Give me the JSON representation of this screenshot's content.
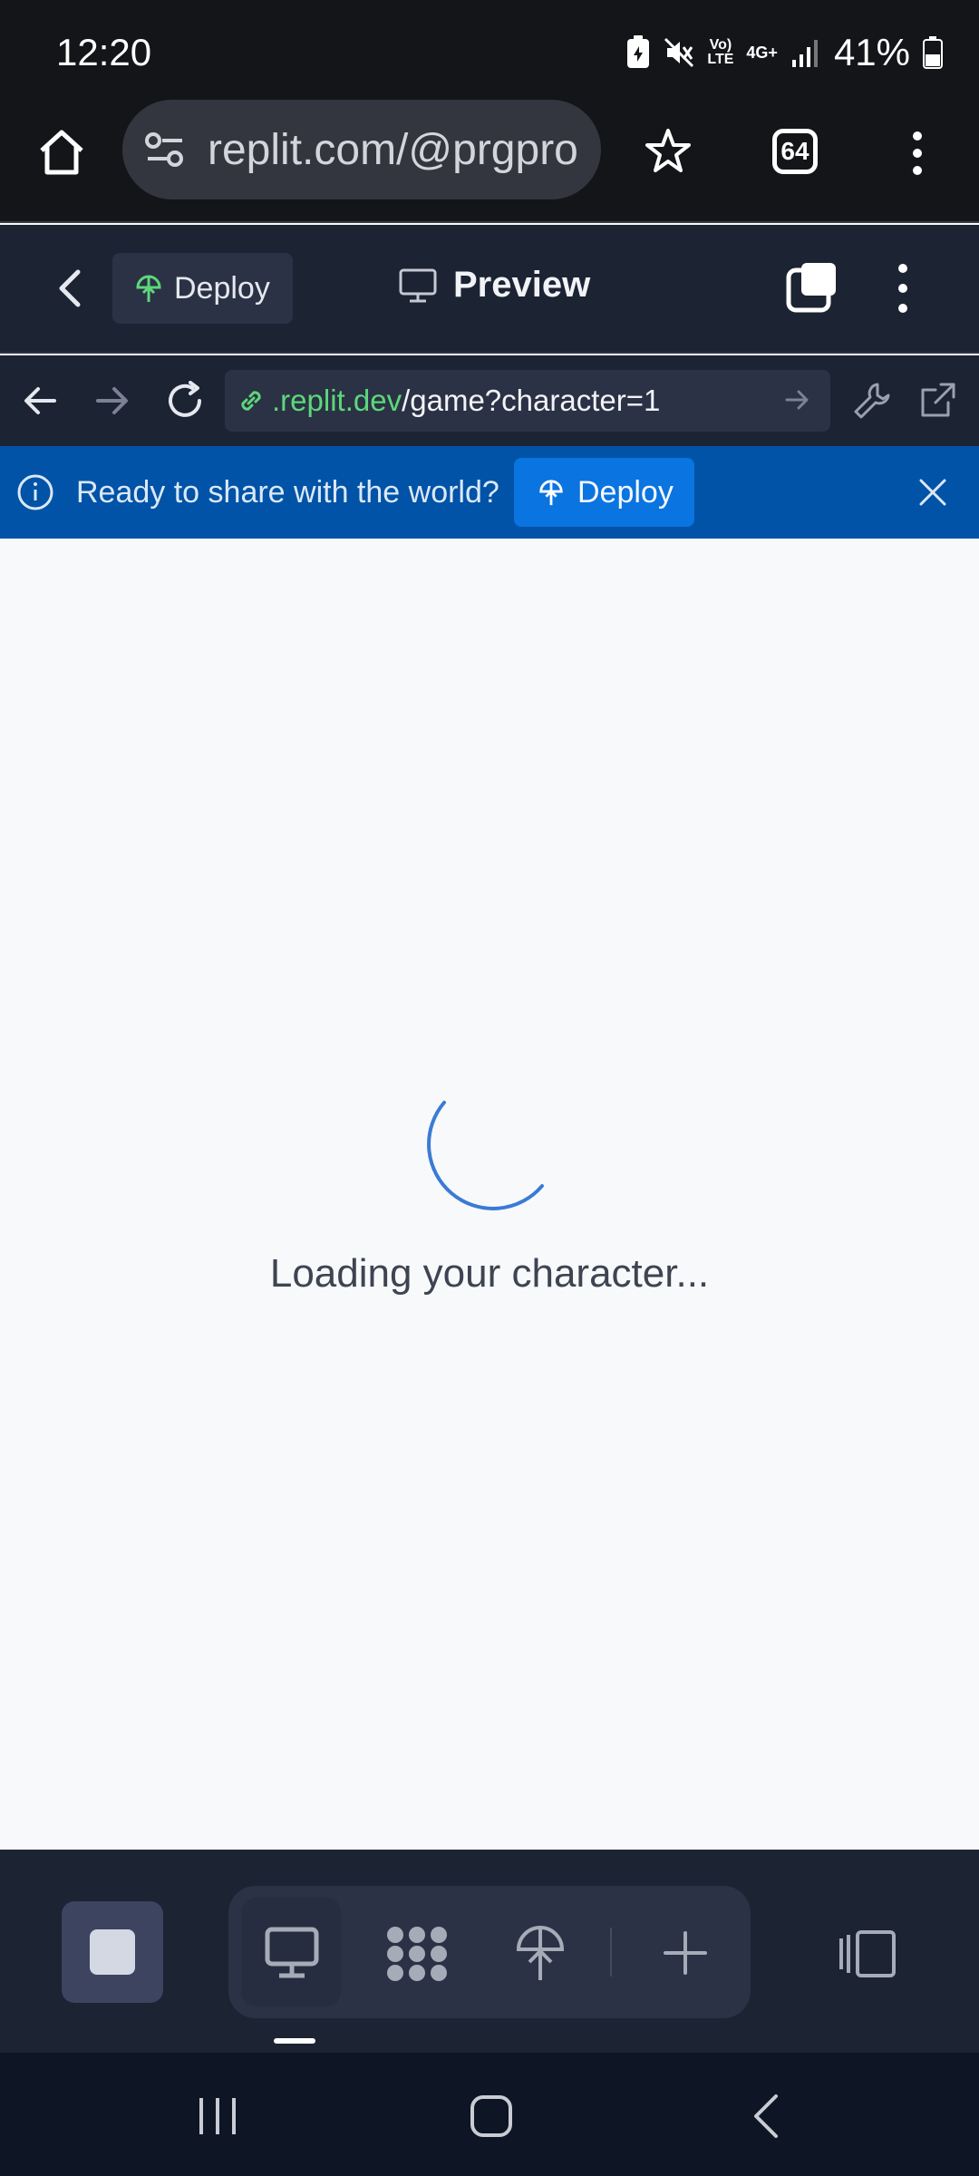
{
  "status_bar": {
    "time": "12:20",
    "battery": "41%",
    "network_label_1": "Vo)\nLTE",
    "network_label_2": "4G+"
  },
  "browser": {
    "url": "replit.com/@prgpro",
    "tab_count": "64"
  },
  "replit_header": {
    "deploy_label": "Deploy",
    "preview_label": "Preview"
  },
  "preview_nav": {
    "url_domain": ".replit.dev",
    "url_path": "/game?character=1"
  },
  "banner": {
    "message": "Ready to share with the world?",
    "deploy_label": "Deploy"
  },
  "content": {
    "loading_text": "Loading your character..."
  },
  "colors": {
    "status_bg": "#141518",
    "replit_bg": "#1c2333",
    "banner_bg": "#0053a6",
    "accent_green": "#5dd77b",
    "spinner_blue": "#3a7bd5"
  },
  "icons": [
    "home-icon",
    "site-settings-icon",
    "star-icon",
    "tabs-icon",
    "more-icon",
    "back-chevron-icon",
    "deploy-icon",
    "monitor-icon",
    "window-icon",
    "arrow-left-icon",
    "arrow-right-icon",
    "refresh-icon",
    "link-icon",
    "wrench-icon",
    "external-link-icon",
    "info-icon",
    "close-icon",
    "spinner-icon",
    "stop-icon",
    "console-icon",
    "plus-icon",
    "panel-icon"
  ]
}
